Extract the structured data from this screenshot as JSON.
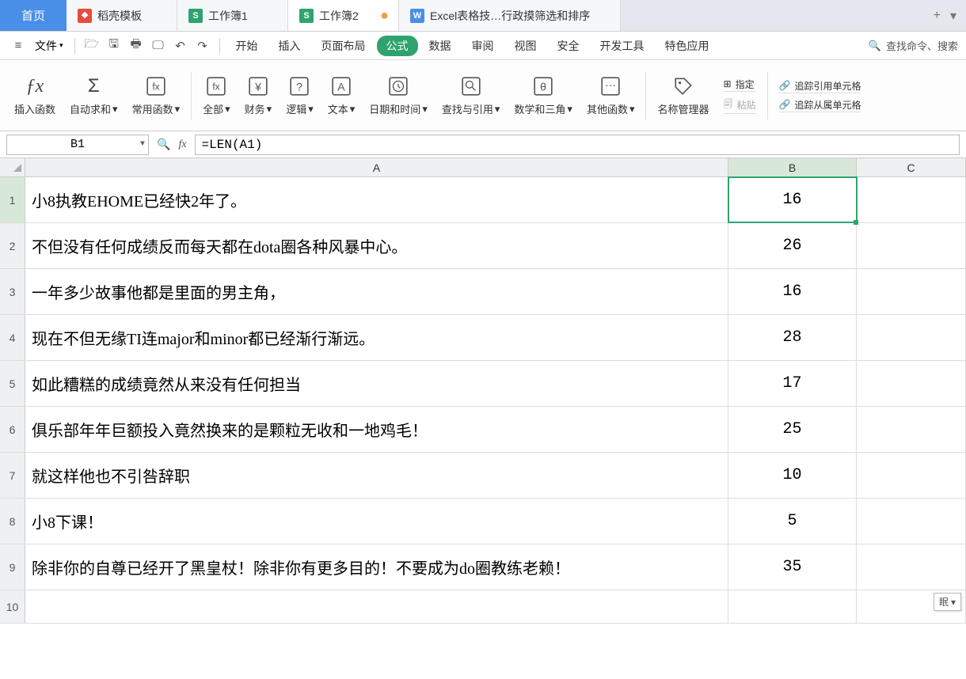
{
  "tabs": {
    "home": "首页",
    "items": [
      {
        "icon": "red",
        "iconText": "❖",
        "label": "稻壳模板"
      },
      {
        "icon": "green",
        "iconText": "S",
        "label": "工作簿1"
      },
      {
        "icon": "green",
        "iconText": "S",
        "label": "工作簿2",
        "active": true,
        "mark": "●"
      },
      {
        "icon": "blue",
        "iconText": "W",
        "label": "Excel表格技…行政摸筛选和排序"
      }
    ],
    "extraPlus": "+"
  },
  "menu": {
    "hamburger": "≡",
    "file": "文件",
    "fileDrop": "▾",
    "qat": [
      "🗁",
      "🖫",
      "🖶",
      "🖵",
      "↶",
      "↷"
    ],
    "items": [
      "开始",
      "插入",
      "页面布局",
      "公式",
      "数据",
      "审阅",
      "视图",
      "安全",
      "开发工具",
      "特色应用"
    ],
    "activeIndex": 3,
    "searchIcon": "🔍",
    "searchPlaceholder": "查找命令、搜索"
  },
  "ribbon": {
    "insert_fn": {
      "icon": "ƒx",
      "label": "插入函数"
    },
    "autosum": {
      "icon": "Σ",
      "label": "自动求和"
    },
    "common": {
      "icon": "⭐",
      "label": "常用函数"
    },
    "all": {
      "icon": "⊞",
      "label": "全部"
    },
    "finance": {
      "icon": "¥",
      "label": "财务"
    },
    "logic": {
      "icon": "?",
      "label": "逻辑"
    },
    "text": {
      "icon": "A",
      "label": "文本"
    },
    "datetime": {
      "icon": "◷",
      "label": "日期和时间"
    },
    "lookup": {
      "icon": "🔍",
      "label": "查找与引用"
    },
    "math": {
      "icon": "θ",
      "label": "数学和三角"
    },
    "other": {
      "icon": "⋯",
      "label": "其他函数"
    },
    "name_mgr": {
      "icon": "🏷",
      "label": "名称管理器"
    },
    "paste": "粘贴",
    "define": "指定",
    "trace_pre": "追踪引用单元格",
    "trace_dep": "追踪从属单元格"
  },
  "formula_bar": {
    "name_box": "B1",
    "zoom_icon": "🔍",
    "fx": "fx",
    "formula": "=LEN(A1)"
  },
  "columns": [
    "A",
    "B",
    "C"
  ],
  "selected": {
    "row": 1,
    "col": "B"
  },
  "rows": [
    {
      "A": "小8执教EHOME已经快2年了。",
      "B": "16"
    },
    {
      "A": "不但没有任何成绩反而每天都在dota圈各种风暴中心。",
      "B": "26"
    },
    {
      "A": "一年多少故事他都是里面的男主角，",
      "B": "16"
    },
    {
      "A": "现在不但无缘TI连major和minor都已经渐行渐远。",
      "B": "28"
    },
    {
      "A": "如此糟糕的成绩竟然从来没有任何担当",
      "B": "17"
    },
    {
      "A": "俱乐部年年巨额投入竟然换来的是颗粒无收和一地鸡毛！",
      "B": "25"
    },
    {
      "A": "就这样他也不引咎辞职",
      "B": "10"
    },
    {
      "A": "小8下课！",
      "B": "5"
    },
    {
      "A": "除非你的自尊已经开了黑皇杖！除非你有更多目的！不要成为do圈教练老赖！",
      "B": "35"
    },
    {
      "A": "",
      "B": ""
    }
  ],
  "paste_tag": "眠"
}
